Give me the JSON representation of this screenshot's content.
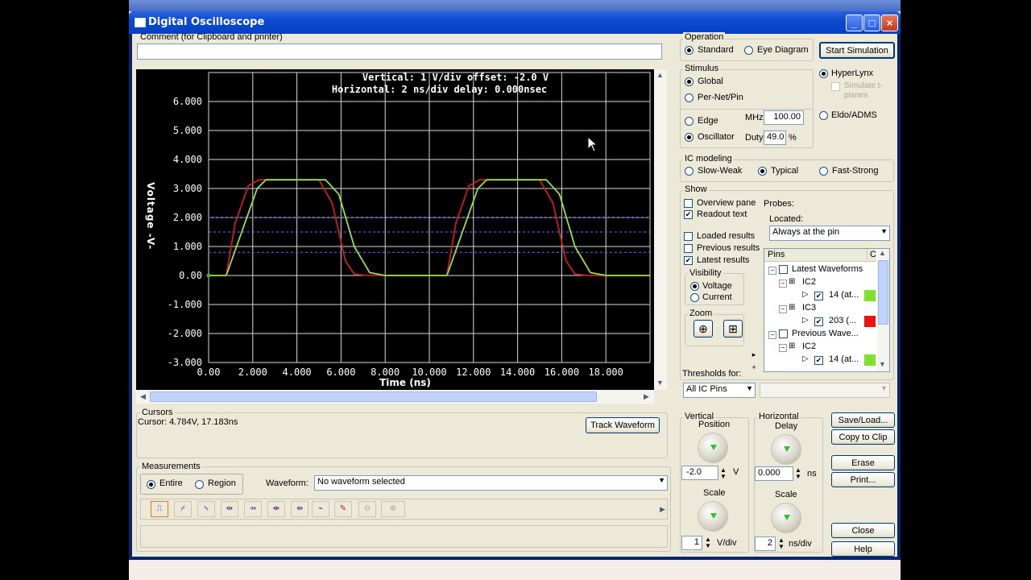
{
  "window": {
    "title": "Digital Oscilloscope",
    "min": "_",
    "max": "□",
    "close": "×"
  },
  "comment": {
    "label": "Comment (for Clipboard and printer)",
    "value": ""
  },
  "scope": {
    "vertical_readout": "Vertical: 1  V/div  offset: -2.0 V",
    "horizontal_readout": "Horizontal: 2 ns/div  delay: 0.000nsec",
    "ylabel": "Voltage -V-",
    "xlabel": "Time  (ns)",
    "ytick_labels": [
      "6.000",
      "5.000",
      "4.000",
      "3.000",
      "2.000",
      "1.000",
      "0.00",
      "-1.000",
      "-2.000",
      "-3.000"
    ],
    "xtick_labels": [
      "0.00",
      "2.000",
      "4.000",
      "6.000",
      "8.000",
      "10.000",
      "12.000",
      "14.000",
      "16.000",
      "18.000"
    ]
  },
  "chart_data": {
    "type": "line",
    "xlabel": "Time  (ns)",
    "ylabel": "Voltage -V-",
    "xlim": [
      0,
      20
    ],
    "ylim": [
      -3,
      7
    ],
    "grid": true,
    "threshold_lines_v": [
      2.0,
      1.5,
      0.8
    ],
    "series": [
      {
        "color": "#c81e1e",
        "x": [
          0,
          0.8,
          1.2,
          1.8,
          2.3,
          5.0,
          5.6,
          6.2,
          6.6,
          7.2,
          10.0,
          10.8,
          11.2,
          11.8,
          12.3,
          15.0,
          15.6,
          16.2,
          16.6,
          17.2,
          20.0
        ],
        "y": [
          0,
          0,
          1.8,
          3.1,
          3.3,
          3.3,
          2.5,
          0.5,
          0.05,
          0,
          0,
          0,
          1.8,
          3.1,
          3.3,
          3.3,
          2.5,
          0.5,
          0.05,
          0,
          0
        ]
      },
      {
        "color": "#9be04e",
        "x": [
          0,
          0.8,
          1.5,
          2.2,
          2.6,
          5.3,
          5.9,
          6.6,
          7.3,
          8.0,
          10.0,
          10.8,
          11.5,
          12.2,
          12.6,
          15.3,
          15.9,
          16.6,
          17.3,
          18.0,
          20.0
        ],
        "y": [
          0,
          0,
          1.5,
          3.0,
          3.3,
          3.3,
          2.8,
          1.0,
          0.1,
          0,
          0,
          0,
          1.5,
          3.0,
          3.3,
          3.3,
          2.8,
          1.0,
          0.1,
          0,
          0
        ]
      }
    ]
  },
  "operation": {
    "label": "Operation",
    "standard": "Standard",
    "eye": "Eye Diagram",
    "selected": "standard"
  },
  "start_sim": "Start Simulation",
  "stimulus": {
    "label": "Stimulus",
    "global": "Global",
    "pernet": "Per-Net/Pin",
    "edge": "Edge",
    "oscillator": "Oscillator",
    "mhz_label": "MHz",
    "mhz_value": "100.00",
    "duty_label": "Duty",
    "duty_value": "49.0",
    "duty_unit": "%"
  },
  "engines": {
    "hyperlynx": "HyperLynx",
    "simulate_tplanes": "Simulate t-planes",
    "eldo": "Eldo/ADMS"
  },
  "ic_modeling": {
    "label": "IC modeling",
    "slow": "Slow-Weak",
    "typical": "Typical",
    "fast": "Fast-Strong"
  },
  "show": {
    "label": "Show",
    "overview": "Overview pane",
    "readout": "Readout text",
    "loaded": "Loaded results",
    "previous": "Previous results",
    "latest": "Latest results",
    "probes": "Probes:",
    "located": "Located:",
    "located_value": "Always at the pin",
    "visibility": "Visibility",
    "voltage": "Voltage",
    "current": "Current",
    "zoom": "Zoom",
    "thresholds_label": "Thresholds for:",
    "thresholds_value": "All IC Pins"
  },
  "pins": {
    "header": "Pins",
    "header_c": "C",
    "rows": [
      {
        "label": "Latest Waveforms"
      },
      {
        "label": "IC2"
      },
      {
        "label": "14 (at..."
      },
      {
        "label": "IC3"
      },
      {
        "label": "203 (..."
      },
      {
        "label": "Previous Wave..."
      },
      {
        "label": "IC2"
      },
      {
        "label": "14 (at..."
      }
    ]
  },
  "cursors": {
    "label": "Cursors",
    "value": "Cursor: 4.784V, 17.183ns",
    "track": "Track Waveform"
  },
  "measurements": {
    "label": "Measurements",
    "entire": "Entire",
    "region": "Region",
    "waveform_label": "Waveform:",
    "waveform_value": "No waveform selected"
  },
  "vertical": {
    "label": "Vertical",
    "position": "Position",
    "pos_value": "-2.0",
    "pos_unit": "V",
    "scale": "Scale",
    "scale_value": "1",
    "scale_unit": "V/div"
  },
  "horizontal": {
    "label": "Horizontal",
    "delay": "Delay",
    "delay_value": "0.000",
    "delay_unit": "ns",
    "scale": "Scale",
    "scale_value": "2",
    "scale_unit": "ns/div"
  },
  "buttons": {
    "save": "Save/Load...",
    "copy": "Copy to Clip",
    "erase": "Erase",
    "print": "Print...",
    "close": "Close",
    "help": "Help"
  }
}
